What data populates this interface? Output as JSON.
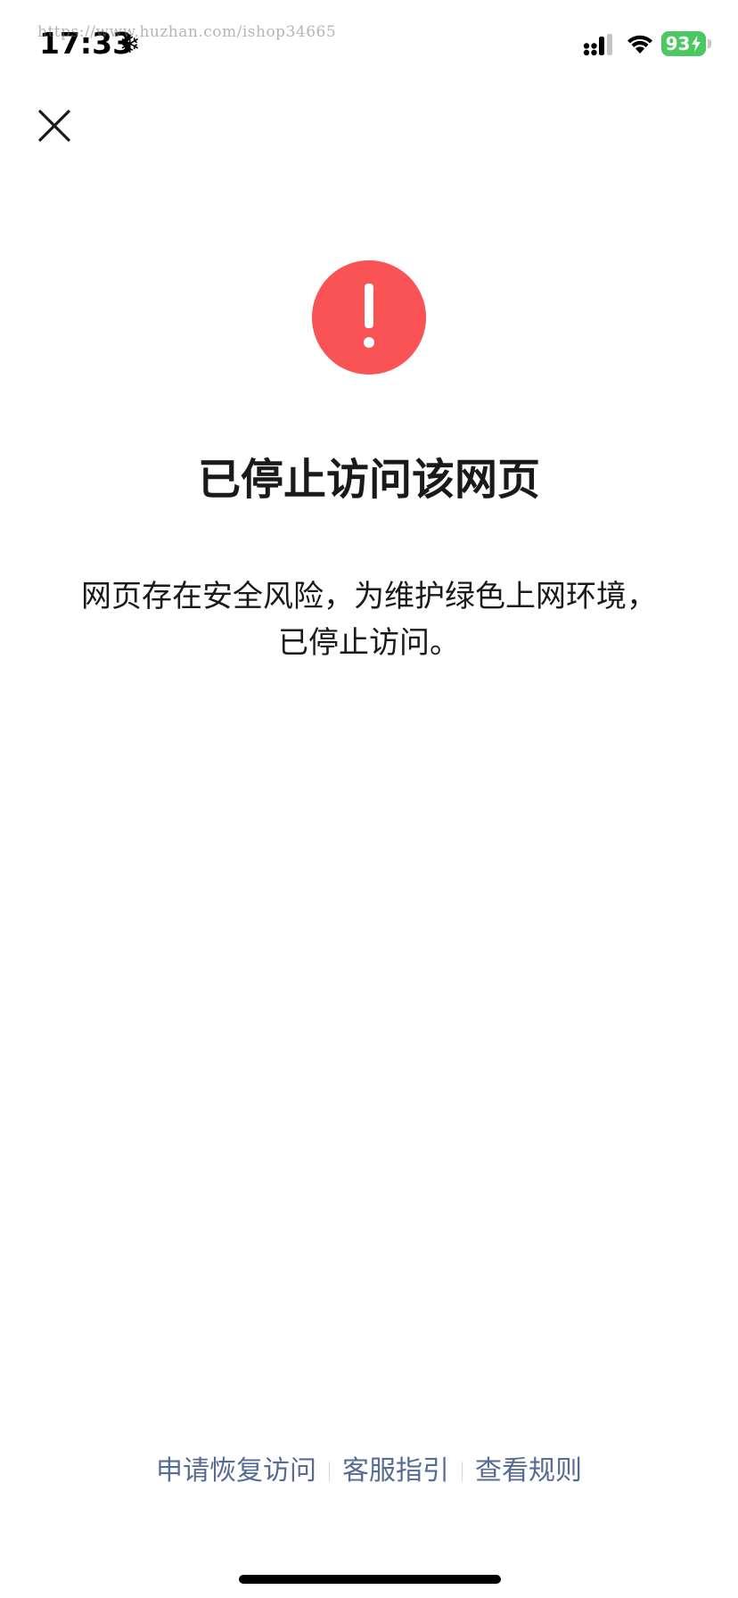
{
  "watermark": {
    "text": "https://www.huzhan.com/ishop34665"
  },
  "status_bar": {
    "time": "17:33",
    "snow_glyph": "❄",
    "battery_level": "93",
    "battery_color": "#4bc85f"
  },
  "icons": {
    "close": "close-icon",
    "warning": "exclamation-circle-icon",
    "signal": "cellular-signal-icon",
    "wifi": "wifi-icon",
    "bolt": "charging-bolt-icon"
  },
  "content": {
    "title": "已停止访问该网页",
    "message": "网页存在安全风险，为维护绿色上网环境，已停止访问。",
    "warning_color": "#f95356"
  },
  "footer": {
    "links": [
      "申请恢复访问",
      "客服指引",
      "查看规则"
    ],
    "link_color": "#576b95"
  }
}
